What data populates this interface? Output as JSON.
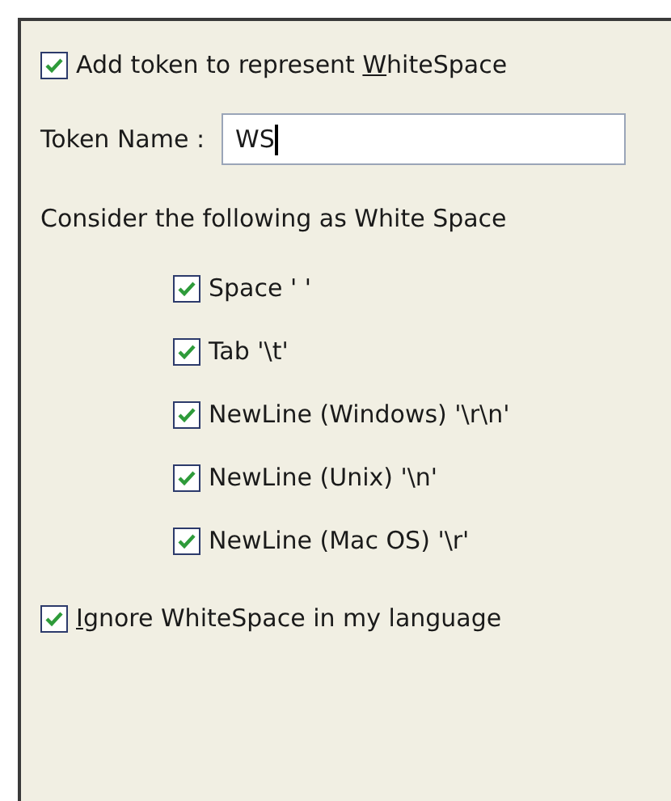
{
  "add_token": {
    "checked": true,
    "text_before": "Add token to represent ",
    "access_key": "W",
    "text_after": "hiteSpace"
  },
  "token_name": {
    "label": "Token Name :",
    "value": "WS"
  },
  "consider_label": "Consider the following as White Space",
  "whitespace_options": [
    {
      "label": "Space ' '",
      "checked": true
    },
    {
      "label": "Tab '\\t'",
      "checked": true
    },
    {
      "label": "NewLine (Windows) '\\r\\n'",
      "checked": true
    },
    {
      "label": "NewLine (Unix) '\\n'",
      "checked": true
    },
    {
      "label": "NewLine (Mac OS) '\\r'",
      "checked": true
    }
  ],
  "ignore_whitespace": {
    "checked": true,
    "access_key": "I",
    "text_after": "gnore WhiteSpace in my language"
  }
}
